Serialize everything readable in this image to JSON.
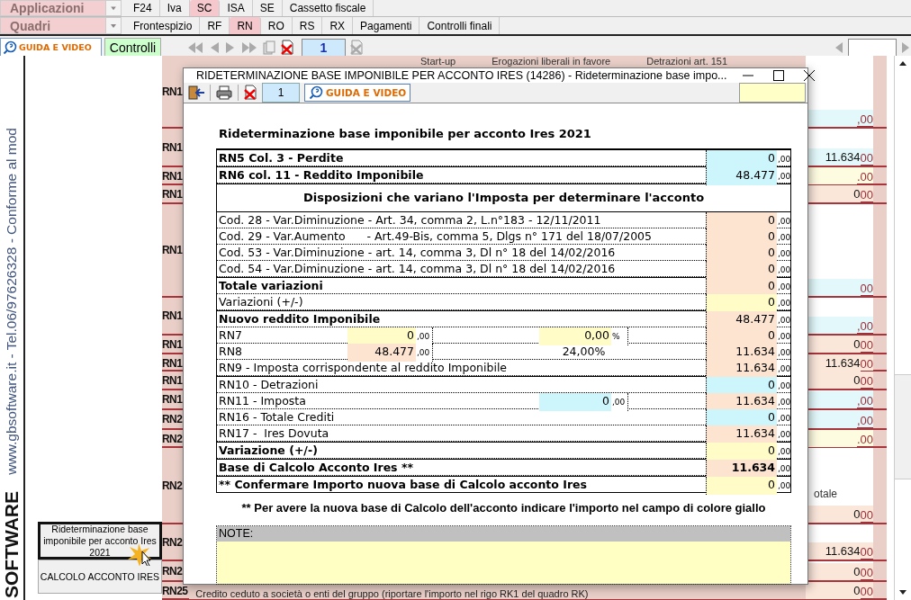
{
  "menus": [
    {
      "label": "Applicazioni",
      "tabs": [
        {
          "label": "F24",
          "selected": false
        },
        {
          "label": "Iva",
          "selected": false
        },
        {
          "label": "SC",
          "selected": true
        },
        {
          "label": "ISA",
          "selected": false
        },
        {
          "label": "SE",
          "selected": false
        },
        {
          "label": "Cassetto fiscale",
          "selected": false
        }
      ]
    },
    {
      "label": "Quadri",
      "tabs": [
        {
          "label": "Frontespizio",
          "selected": false
        },
        {
          "label": "RF",
          "selected": false
        },
        {
          "label": "RN",
          "selected": true
        },
        {
          "label": "RO",
          "selected": false
        },
        {
          "label": "RS",
          "selected": false
        },
        {
          "label": "RX",
          "selected": false
        },
        {
          "label": "Pagamenti",
          "selected": false
        },
        {
          "label": "Controlli finali",
          "selected": false
        }
      ]
    }
  ],
  "toolbar": {
    "help_button": "GUIDA E VIDEO",
    "controls_button": "Controlli",
    "page": "1"
  },
  "sidebar": {
    "vertical_text": "www.gbsoftware.it - Tel.06/97626328 - Conforme al mod",
    "brand": "SOFTWARE",
    "buttons": [
      {
        "label": "Rideterminazione base imponibile per acconto Ires 2021",
        "focused": true
      },
      {
        "label": "CALCOLO ACCONTO IRES",
        "focused": false
      }
    ]
  },
  "form": {
    "headers": [
      "Start-up",
      "Erogazioni liberali in favore",
      "Detrazioni art. 151"
    ],
    "rows": [
      {
        "label": "RN1",
        "cents": ",00",
        "color": "#e2f8fa"
      },
      {
        "label": "RN1",
        "amount": "11.634",
        "cents": "00",
        "color": "#e2f8fa"
      },
      {
        "label": "RN1",
        "cents": ".00",
        "color": "#fdfbe0"
      },
      {
        "label": "RN1",
        "amount": "0",
        "cents": "00",
        "color": "#fbe6da"
      },
      {
        "label": "RN1",
        "cents": "00",
        "color": "#e2f8fa"
      },
      {
        "label": "RN1",
        "cents": ",00",
        "color": "#e2f8fa"
      },
      {
        "label": "RN1",
        "amount": "0",
        "cents": "00",
        "color": "#fbe6da"
      },
      {
        "label": "RN1",
        "amount": "11.634",
        "cents": "00",
        "color": "#fbe6da"
      },
      {
        "label": "RN1",
        "amount": "0",
        "cents": "00",
        "color": "#fbe6da"
      },
      {
        "label": "RN1",
        "cents": ",00",
        "color": "#e2f8fa"
      },
      {
        "label": "RN2",
        "cents": ",00",
        "color": "#e2f8fa"
      },
      {
        "label": "RN2",
        "cents": ".00",
        "color": "#fdfbe0"
      },
      {
        "label": "RN2",
        "caption": "otale",
        "amount": "0",
        "cents": "00",
        "color": "#fbe6da"
      },
      {
        "label": "RN2",
        "amount": "11.634",
        "cents": "00",
        "color": "#fbe6da"
      },
      {
        "label": "RN2",
        "amount": "0",
        "cents": "00",
        "color": "#fbe6da"
      },
      {
        "label": "RN25",
        "description": "Credito ceduto a società o enti del gruppo (riportare l'importo nel rigo RK1 del quadro RK)",
        "amount": "0",
        "cents": "00",
        "color": "#fbe6da"
      }
    ]
  },
  "dialog": {
    "title": "RIDETERMINAZIONE BASE IMPONIBILE PER ACCONTO IRES (14286) - Rideterminazione base impo...",
    "page": "1",
    "help_button": "GUIDA E VIDEO",
    "heading": "Rideterminazione base imponibile per acconto Ires 2021",
    "rows": [
      {
        "kind": "total",
        "label": "RN5 Col. 3 - Perdite",
        "value": "0",
        "cents": ",00",
        "color": "#ccf5fc"
      },
      {
        "kind": "total",
        "label": "RN6 col. 11 - Reddito Imponibile",
        "value": "48.477",
        "cents": ",00",
        "color": "#ccf5fc"
      },
      {
        "kind": "section",
        "label": "Disposizioni che variano l'Imposta per determinare l'acconto"
      },
      {
        "kind": "item",
        "label": "Cod. 28 - Var.Diminuzione - Art. 34, comma 2, L.n°183 - 12/11/2011",
        "value": "0",
        "cents": ",00",
        "color": "#fce4d0"
      },
      {
        "kind": "item",
        "label": "Cod. 29 - Var.Aumento      - Art.49-Bis, comma 5, Dlgs n° 171 del 18/07/2005",
        "value": "0",
        "cents": ",00",
        "color": "#fce4d0"
      },
      {
        "kind": "item",
        "label": "Cod. 53 - Var.Diminuzione - art. 14, comma 3, Dl n° 18 del 14/02/2016",
        "value": "0",
        "cents": ",00",
        "color": "#fce4d0"
      },
      {
        "kind": "item",
        "label": "Cod. 54 - Var.Diminuzione - art. 14, comma 3, Dl n° 18 del 14/02/2016",
        "value": "0",
        "cents": ",00",
        "color": "#fce4d0"
      },
      {
        "kind": "total",
        "label": "Totale variazioni",
        "value": "0",
        "cents": ",00",
        "color": "#fce4d0"
      },
      {
        "kind": "item",
        "label": "Variazioni (+/-)",
        "value": "0",
        "cents": ",00",
        "color": "#fffcc8"
      },
      {
        "kind": "total",
        "label": "Nuovo reddito Imponibile",
        "value": "48.477",
        "cents": ",00",
        "color": "#fce4d0"
      },
      {
        "kind": "split",
        "label": "RN7",
        "mid_left": {
          "value": "0",
          "cents": ",00",
          "color": "#fffcc8"
        },
        "mid_right": {
          "value": "0,00",
          "cents": "%",
          "color": "#fffcc8"
        },
        "value": "0",
        "cents": ",00",
        "color": "#fce4d0"
      },
      {
        "kind": "split",
        "label": "RN8",
        "mid_left": {
          "value": "48.477",
          "cents": ",00",
          "color": "#fce4d0"
        },
        "mid_right": {
          "text": "24,00%"
        },
        "value": "11.634",
        "cents": ",00",
        "color": "#fce4d0"
      },
      {
        "kind": "item",
        "label": "RN9 - Imposta corrispondente al reddito Imponibile",
        "value": "11.634",
        "cents": ",00",
        "color": "#fce4d0"
      },
      {
        "kind": "group",
        "label": "RN10 - Detrazioni",
        "value": "0",
        "cents": ",00",
        "color": "#ccf5fc"
      },
      {
        "kind": "split",
        "label": "RN11 - Imposta",
        "mid_right": {
          "value": "0",
          "cents": ",00",
          "color": "#ccf5fc"
        },
        "value": "11.634",
        "cents": ",00",
        "color": "#fce4d0"
      },
      {
        "kind": "item",
        "label": "RN16 - Totale Crediti",
        "value": "0",
        "cents": ",00",
        "color": "#ccf5fc"
      },
      {
        "kind": "item",
        "label": "RN17 -  Ires Dovuta",
        "value": "11.634",
        "cents": ",00",
        "color": "#fce4d0"
      },
      {
        "kind": "total",
        "label": "Variazione (+/-)",
        "value": "0",
        "cents": ",00",
        "color": "#fffcc8"
      },
      {
        "kind": "result",
        "label": "Base di Calcolo Acconto Ires **",
        "value": "11.634",
        "cents": ",00",
        "color": "#fce4d0"
      },
      {
        "kind": "total",
        "label": "** Confermare Importo nuova base di Calcolo acconto Ires",
        "value": "0",
        "cents": ",00",
        "color": "#fffcc8"
      }
    ],
    "footnote": "** Per avere la nuova base di Calcolo dell'acconto indicare l'importo nel campo di colore giallo",
    "notes_label": "NOTE:"
  }
}
